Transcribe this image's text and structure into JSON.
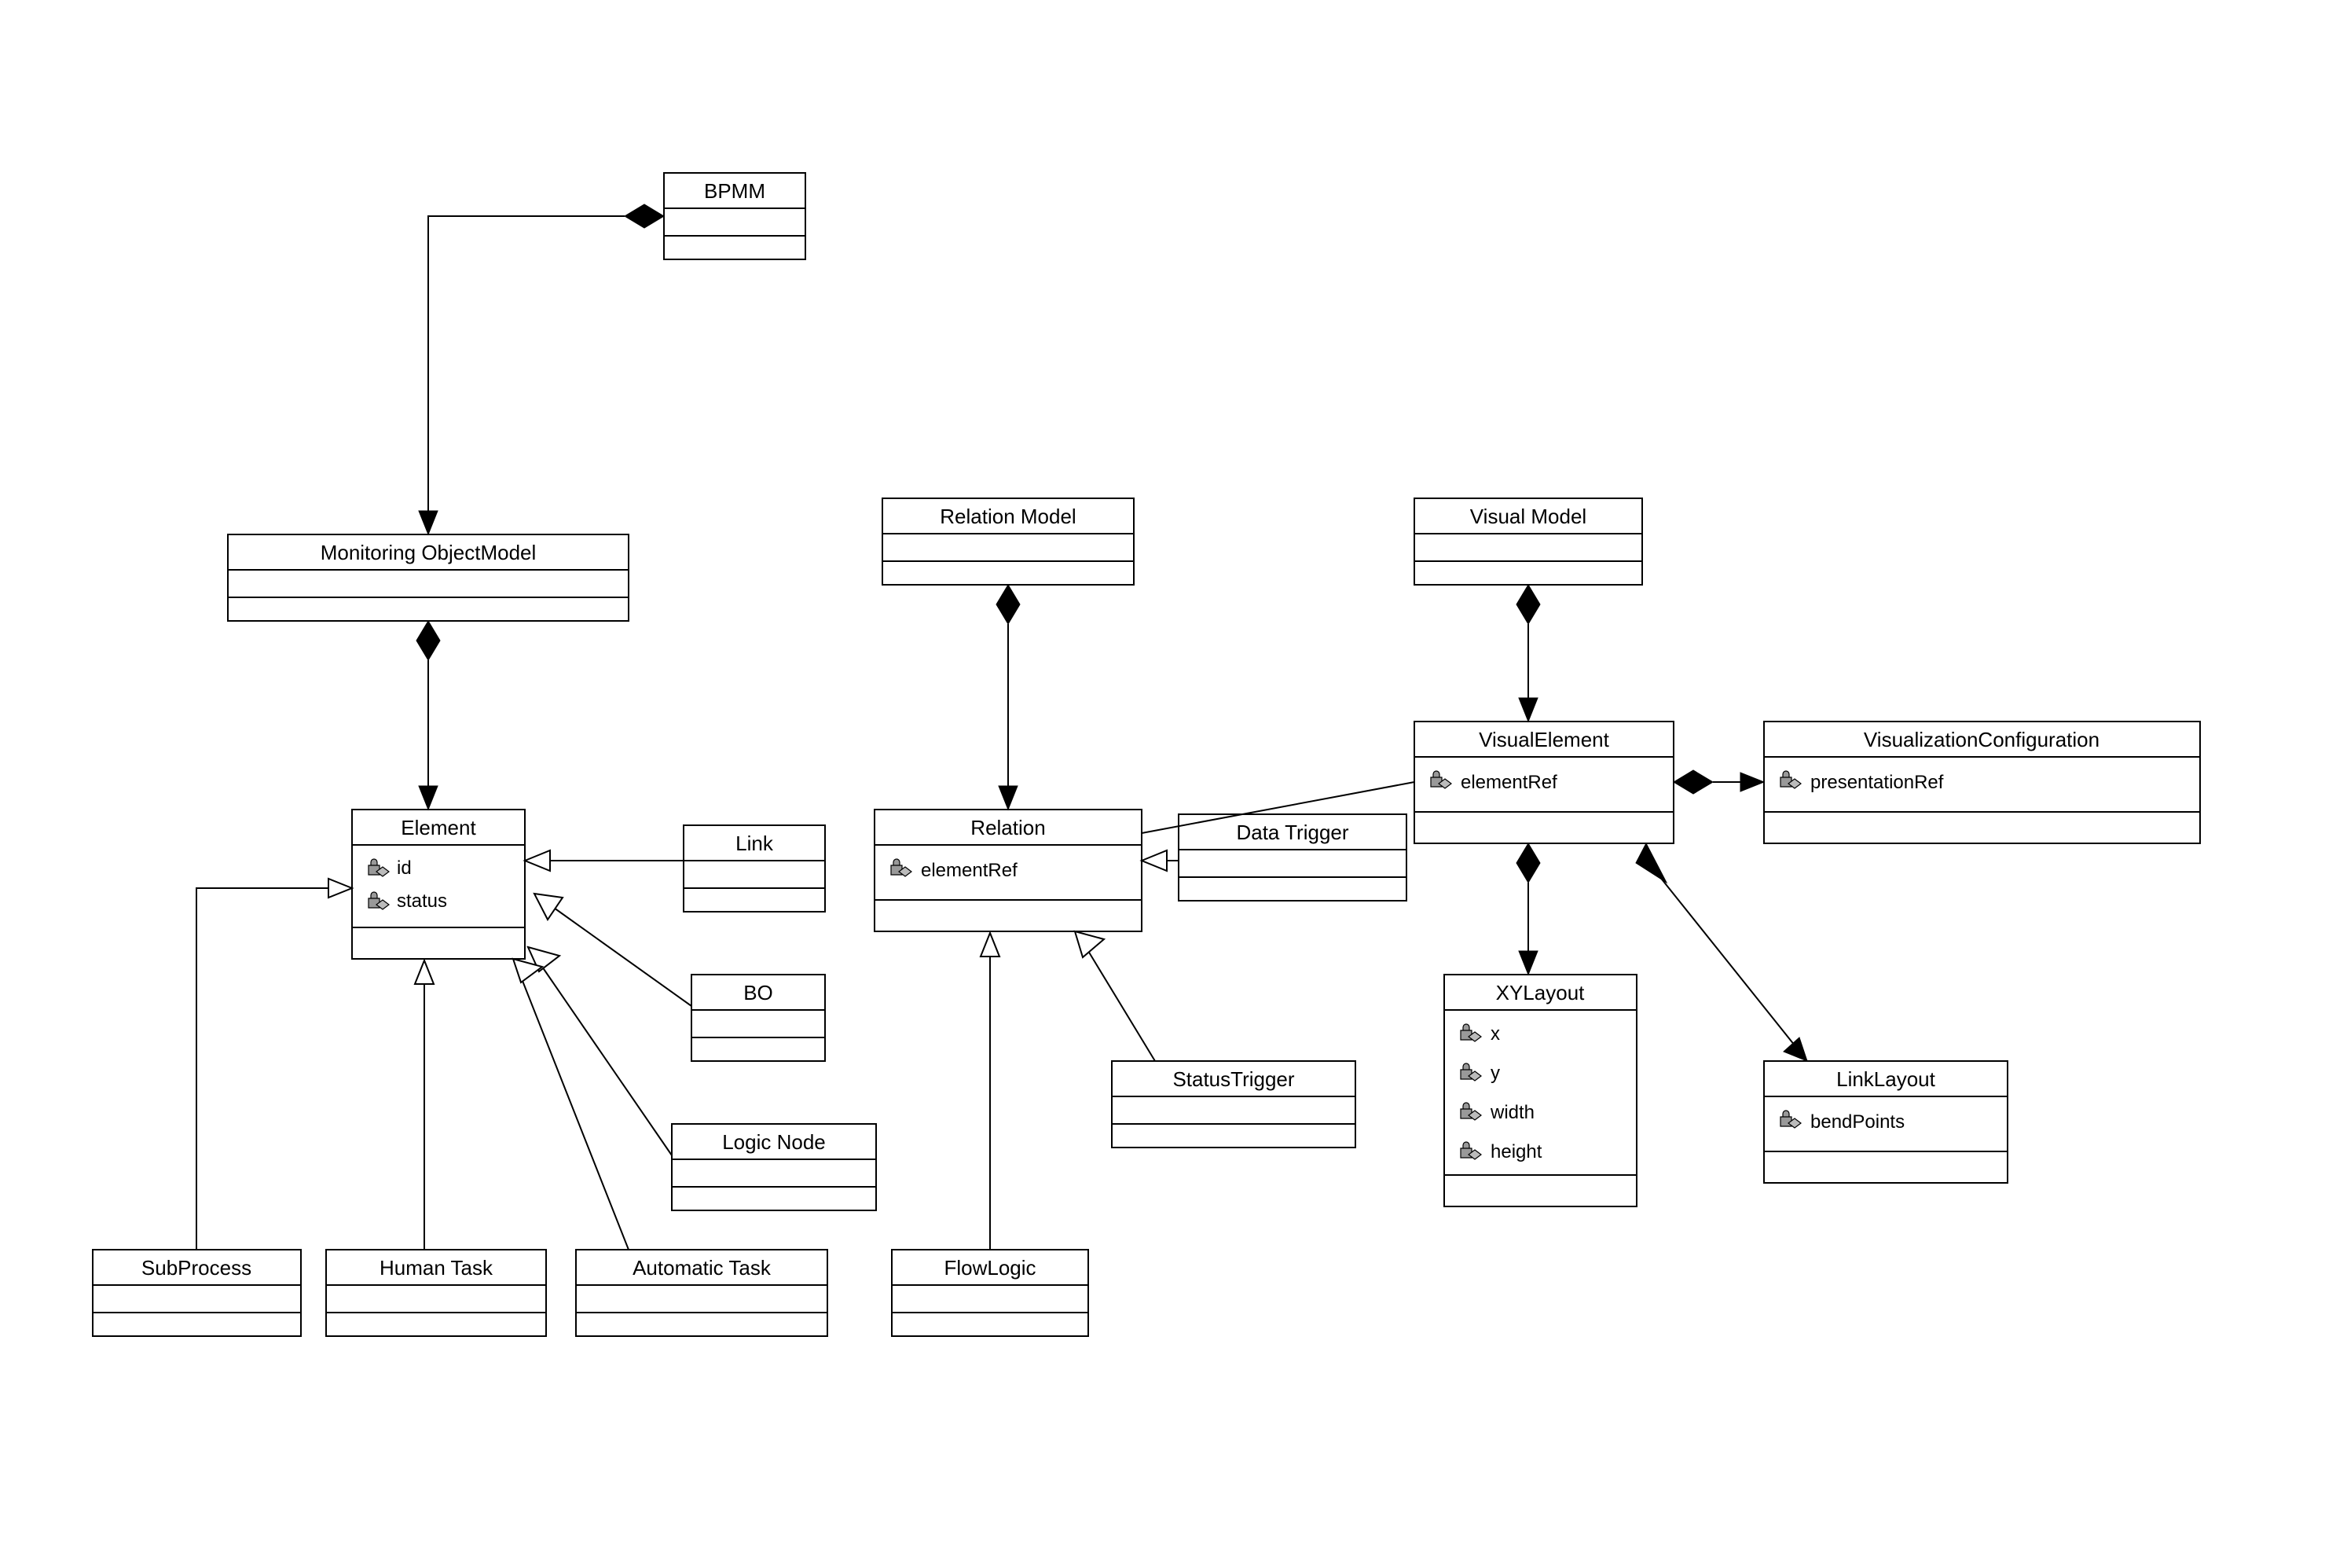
{
  "classes": {
    "bpmm": {
      "name": "BPMM"
    },
    "monitoring": {
      "name": "Monitoring ObjectModel"
    },
    "element": {
      "name": "Element",
      "attrs": [
        "id",
        "status"
      ]
    },
    "link": {
      "name": "Link"
    },
    "bo": {
      "name": "BO"
    },
    "logicnode": {
      "name": "Logic Node"
    },
    "subprocess": {
      "name": "SubProcess"
    },
    "humantask": {
      "name": "Human Task"
    },
    "automatictask": {
      "name": "Automatic Task"
    },
    "relationmodel": {
      "name": "Relation Model"
    },
    "relation": {
      "name": "Relation",
      "attrs": [
        "elementRef"
      ]
    },
    "datatrigger": {
      "name": "Data Trigger"
    },
    "statustrigger": {
      "name": "StatusTrigger"
    },
    "flowlogic": {
      "name": "FlowLogic"
    },
    "visualmodel": {
      "name": "Visual Model"
    },
    "visualelement": {
      "name": "VisualElement",
      "attrs": [
        "elementRef"
      ]
    },
    "visconfig": {
      "name": "VisualizationConfiguration",
      "attrs": [
        "presentationRef"
      ]
    },
    "xylayout": {
      "name": "XYLayout",
      "attrs": [
        "x",
        "y",
        "width",
        "height"
      ]
    },
    "linklayout": {
      "name": "LinkLayout",
      "attrs": [
        "bendPoints"
      ]
    }
  },
  "relations": [
    {
      "from": "bpmm",
      "to": "monitoring",
      "type": "composition"
    },
    {
      "from": "monitoring",
      "to": "element",
      "type": "composition"
    },
    {
      "from": "relationmodel",
      "to": "relation",
      "type": "composition"
    },
    {
      "from": "visualmodel",
      "to": "visualelement",
      "type": "composition"
    },
    {
      "from": "visualelement",
      "to": "visconfig",
      "type": "composition"
    },
    {
      "from": "visualelement",
      "to": "xylayout",
      "type": "composition"
    },
    {
      "from": "visualelement",
      "to": "linklayout",
      "type": "composition"
    },
    {
      "from": "link",
      "to": "element",
      "type": "generalization"
    },
    {
      "from": "bo",
      "to": "element",
      "type": "generalization"
    },
    {
      "from": "logicnode",
      "to": "element",
      "type": "generalization"
    },
    {
      "from": "subprocess",
      "to": "element",
      "type": "generalization"
    },
    {
      "from": "humantask",
      "to": "element",
      "type": "generalization"
    },
    {
      "from": "automatictask",
      "to": "element",
      "type": "generalization"
    },
    {
      "from": "datatrigger",
      "to": "relation",
      "type": "generalization"
    },
    {
      "from": "statustrigger",
      "to": "relation",
      "type": "generalization"
    },
    {
      "from": "flowlogic",
      "to": "relation",
      "type": "generalization"
    },
    {
      "from": "relation",
      "to": "visualelement",
      "type": "association"
    }
  ]
}
